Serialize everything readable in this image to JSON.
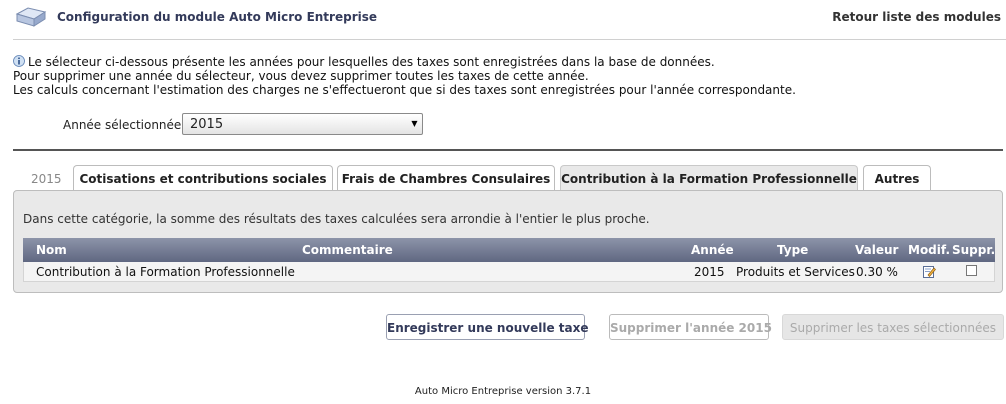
{
  "header": {
    "title": "Configuration du module Auto Micro Entreprise",
    "back_link": "Retour liste des modules"
  },
  "info": {
    "line1": "Le sélecteur ci-dessous présente les années pour lesquelles des taxes sont enregistrées dans la base de données.",
    "line2": "Pour supprimer une année du sélecteur, vous devez supprimer toutes les taxes de cette année.",
    "line3": "Les calculs concernant l'estimation des charges ne s'effectueront que si des taxes sont enregistrées pour l'année correspondante."
  },
  "year_selector": {
    "label": "Année sélectionnée :",
    "value": "2015"
  },
  "tabs": {
    "year": "2015",
    "items": [
      "Cotisations et contributions sociales",
      "Frais de Chambres Consulaires",
      "Contribution à la Formation Professionnelle",
      "Autres"
    ],
    "active_index": 2
  },
  "panel": {
    "description": "Dans cette catégorie, la somme des résultats des taxes calculées sera arrondie à l'entier le plus proche."
  },
  "table": {
    "columns": {
      "nom": "Nom",
      "commentaire": "Commentaire",
      "annee": "Année",
      "type": "Type",
      "valeur": "Valeur",
      "modif": "Modif.",
      "suppr": "Suppr."
    },
    "rows": [
      {
        "nom": "Contribution à la Formation Professionnelle",
        "commentaire": "",
        "annee": "2015",
        "type": "Produits et Services",
        "valeur": "0.30 %"
      }
    ]
  },
  "buttons": {
    "new_tax": "Enregistrer une nouvelle taxe",
    "delete_year": "Supprimer l'année 2015",
    "delete_selected": "Supprimer les taxes sélectionnées"
  },
  "footer": {
    "version": "Auto Micro Entreprise version 3.7.1"
  },
  "colors": {
    "title": "#333a5a",
    "table_header": "#6f7690",
    "panel_bg": "#e9e9e9"
  },
  "icons": {
    "logo": "folder-icon",
    "info": "info-icon",
    "edit": "edit-icon",
    "dropdown": "dropdown-arrow-icon"
  }
}
